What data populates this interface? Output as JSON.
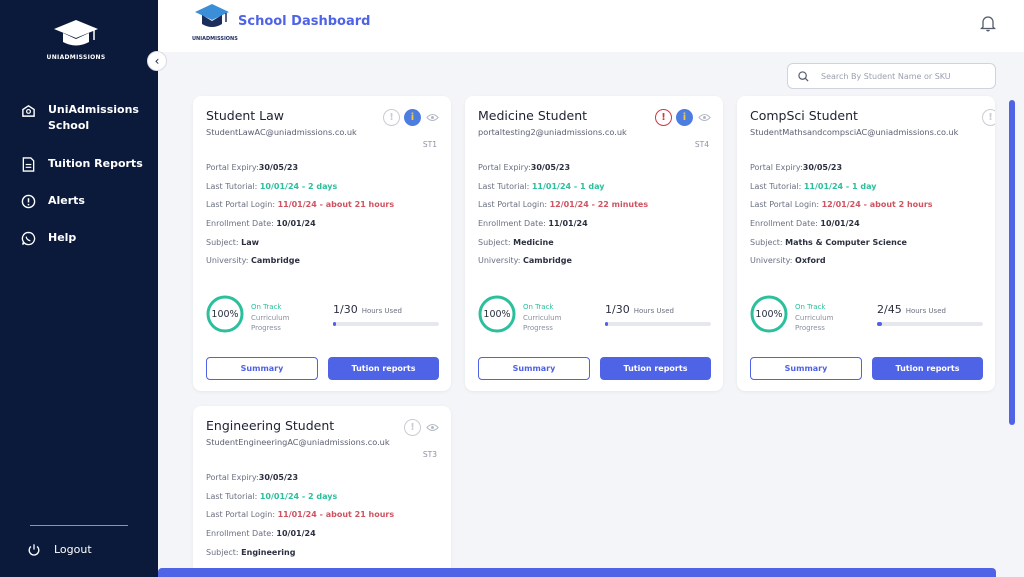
{
  "app": {
    "brand": "UNIADMISSIONS",
    "header_brand": "UNIADMISSIONS",
    "title": "School Dashboard"
  },
  "sidebar": {
    "items": [
      {
        "label": "UniAdmissions School",
        "icon": "school-icon"
      },
      {
        "label": "Tuition Reports",
        "icon": "document-icon"
      },
      {
        "label": "Alerts",
        "icon": "alert-icon"
      },
      {
        "label": "Help",
        "icon": "whatsapp-icon"
      }
    ],
    "logout": "Logout"
  },
  "search": {
    "placeholder": "Search By Student Name or SKU"
  },
  "labels": {
    "portal_expiry": "Portal Expiry:",
    "last_tutorial": "Last Tutorial: ",
    "last_login": "Last Portal Login: ",
    "enrollment": "Enrollment Date: ",
    "subject": "Subject: ",
    "university": "University: ",
    "on_track": "On Track",
    "curriculum": "Curriculum Progress",
    "hours_used": "Hours Used",
    "summary": "Summary",
    "tuition_reports": "Tution reports"
  },
  "students": [
    {
      "name": "Student Law",
      "email": "StudentLawAC@uniadmissions.co.uk",
      "code": "ST1",
      "portal_expiry": "30/05/23",
      "last_tutorial": "10/01/24 - 2 days",
      "last_login": "11/01/24 - about 21 hours",
      "enrollment": "10/01/24",
      "subject": "Law",
      "university": "Cambridge",
      "progress_label": "100%",
      "progress": 1.0,
      "hours": "1/30",
      "hours_fraction": 0.033,
      "alert": "!",
      "info": "i"
    },
    {
      "name": "Medicine Student",
      "email": "portaltesting2@uniadmissions.co.uk",
      "code": "ST4",
      "portal_expiry": "30/05/23",
      "last_tutorial": "11/01/24 - 1 day",
      "last_login": "12/01/24 - 22 minutes",
      "enrollment": "11/01/24",
      "subject": "Medicine",
      "university": "Cambridge",
      "progress_label": "100%",
      "progress": 1.0,
      "hours": "1/30",
      "hours_fraction": 0.033,
      "alert": "!",
      "info": "i"
    },
    {
      "name": "CompSci Student",
      "email": "StudentMathsandcompsciAC@uniadmissions.co.uk",
      "code": "",
      "portal_expiry": "30/05/23",
      "last_tutorial": "11/01/24 - 1 day",
      "last_login": "12/01/24 - about 2 hours",
      "enrollment": "10/01/24",
      "subject": "Maths & Computer Science",
      "university": "Oxford",
      "progress_label": "100%",
      "progress": 1.0,
      "hours": "2/45",
      "hours_fraction": 0.044,
      "alert": "!"
    },
    {
      "name": "Engineering Student",
      "email": "StudentEngineeringAC@uniadmissions.co.uk",
      "code": "ST3",
      "portal_expiry": "30/05/23",
      "last_tutorial": "10/01/24 - 2 days",
      "last_login": "11/01/24 - about 21 hours",
      "enrollment": "10/01/24",
      "subject": "Engineering",
      "alert": "!"
    }
  ],
  "colors": {
    "sidebar": "#0b1a3b",
    "accent": "#4e63e6",
    "green": "#2bc09b",
    "red": "#d05360"
  }
}
